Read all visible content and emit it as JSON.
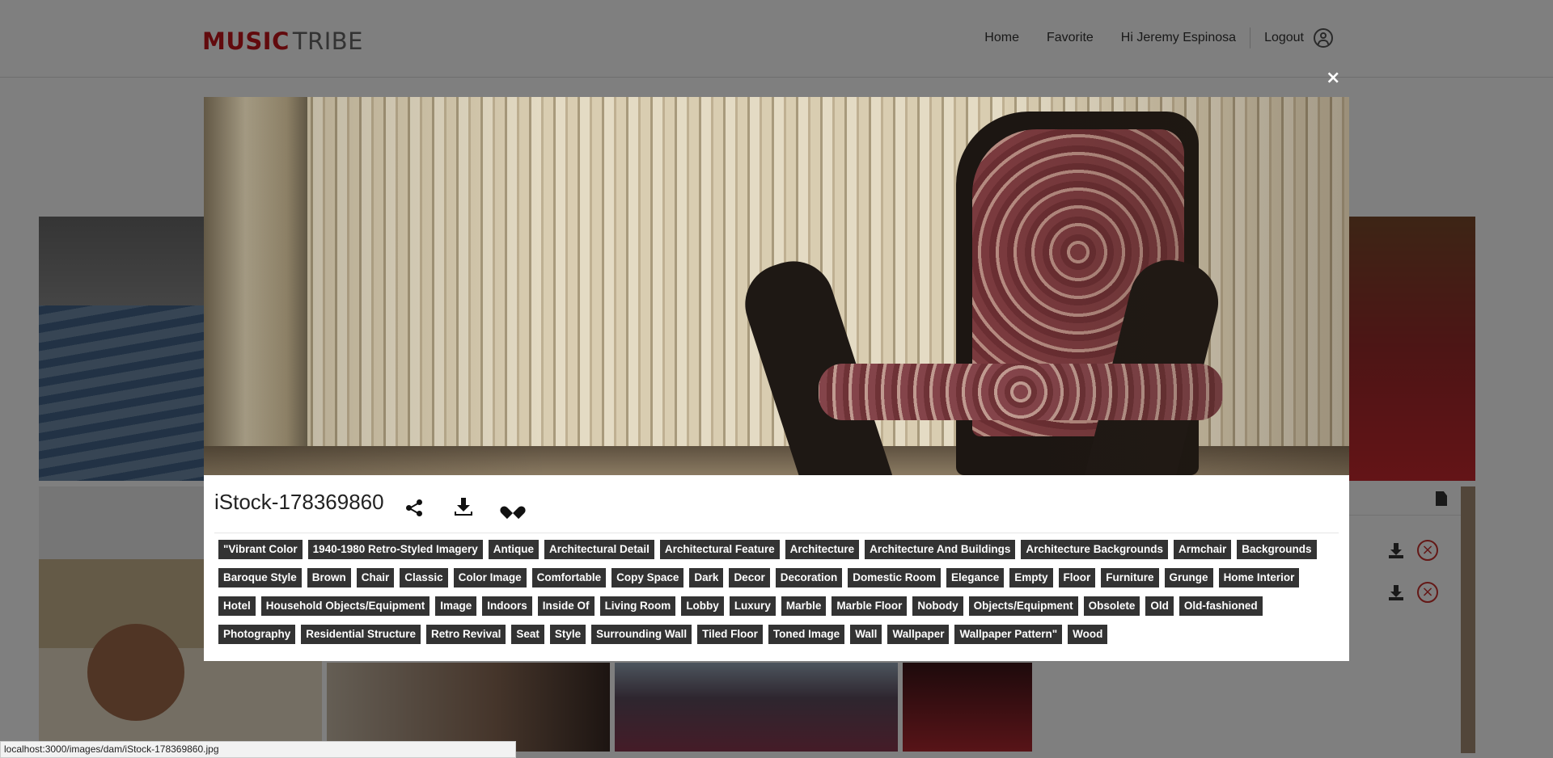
{
  "header": {
    "logo_part1": "MUSIC",
    "logo_part2": "TRIBE",
    "nav": {
      "home": "Home",
      "favorite": "Favorite",
      "greeting": "Hi Jeremy Espinosa",
      "logout": "Logout"
    }
  },
  "modal": {
    "close": "×",
    "title": "iStock-178369860",
    "tags": [
      "\"Vibrant Color",
      "1940-1980 Retro-Styled Imagery",
      "Antique",
      "Architectural Detail",
      "Architectural Feature",
      "Architecture",
      "Architecture And Buildings",
      "Architecture Backgrounds",
      "Armchair",
      "Backgrounds",
      "Baroque Style",
      "Brown",
      "Chair",
      "Classic",
      "Color Image",
      "Comfortable",
      "Copy Space",
      "Dark",
      "Decor",
      "Decoration",
      "Domestic Room",
      "Elegance",
      "Empty",
      "Floor",
      "Furniture",
      "Grunge",
      "Home Interior",
      "Hotel",
      "Household Objects/Equipment",
      "Image",
      "Indoors",
      "Inside Of",
      "Living Room",
      "Lobby",
      "Luxury",
      "Marble",
      "Marble Floor",
      "Nobody",
      "Objects/Equipment",
      "Obsolete",
      "Old",
      "Old-fashioned",
      "Photography",
      "Residential Structure",
      "Retro Revival",
      "Seat",
      "Style",
      "Surrounding Wall",
      "Tiled Floor",
      "Toned Image",
      "Wall",
      "Wallpaper",
      "Wallpaper Pattern\"",
      "Wood"
    ]
  },
  "statusbar": "localhost:3000/images/dam/iStock-178369860.jpg"
}
